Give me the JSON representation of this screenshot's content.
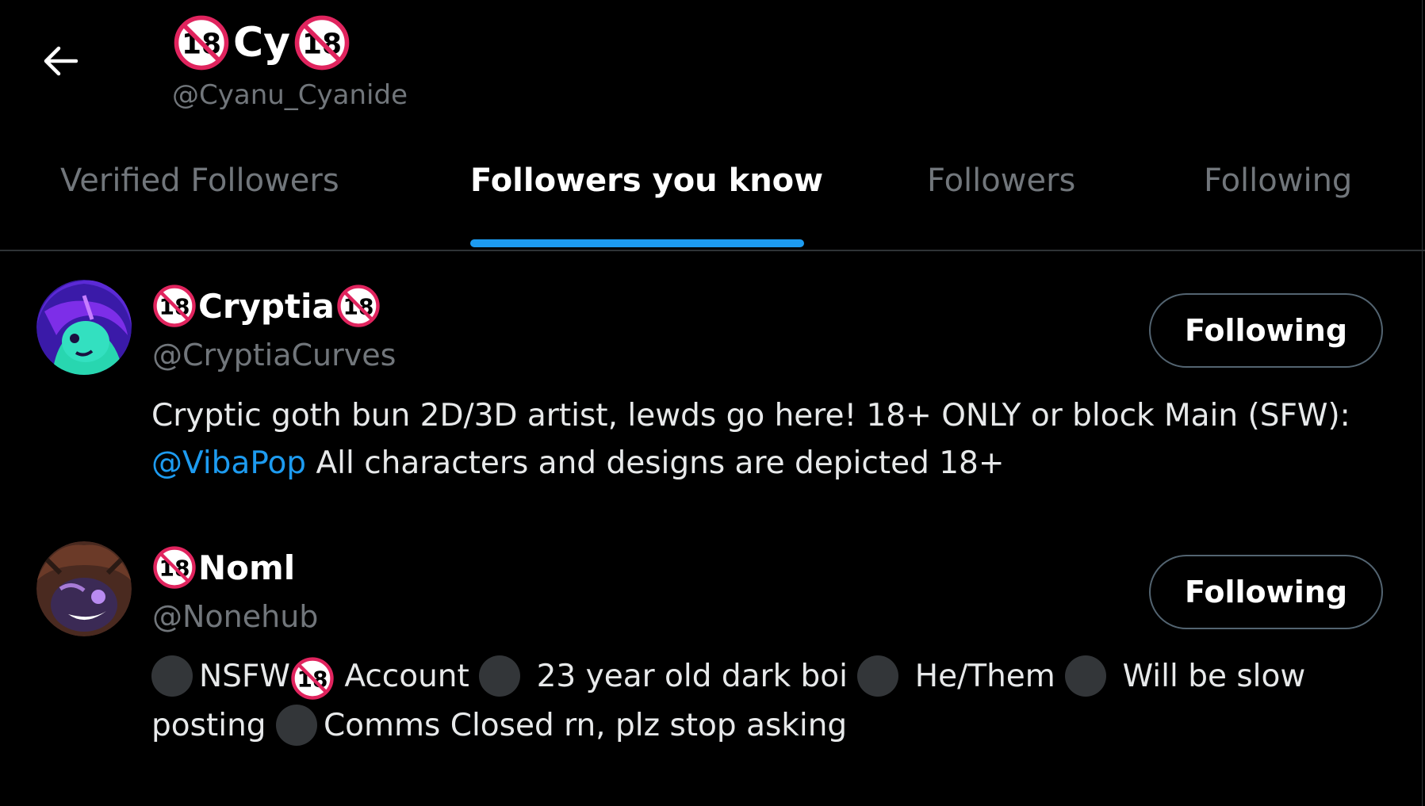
{
  "header": {
    "name": "Cy",
    "handle": "@Cyanu_Cyanide",
    "badge_label": "18"
  },
  "tabs": [
    {
      "label": "Verified Followers",
      "active": false
    },
    {
      "label": "Followers you know",
      "active": true
    },
    {
      "label": "Followers",
      "active": false
    },
    {
      "label": "Following",
      "active": false
    }
  ],
  "users": [
    {
      "name": "Cryptia",
      "handle": "@CryptiaCurves",
      "button_label": "Following",
      "bio_line1": "Cryptic goth bun 2D/3D artist, lewds go here! 18+ ONLY or block Main (SFW):",
      "bio_mention": "@VibaPop",
      "bio_line2": " All characters and designs are depicted 18+"
    },
    {
      "name": "Noml",
      "handle": "@Nonehub",
      "button_label": "Following",
      "bio_seg1": "NSFW",
      "bio_seg2": " Account ",
      "bio_seg3": " 23 year old dark boi ",
      "bio_seg4": " He/Them ",
      "bio_seg5": " Will be slow",
      "bio_seg6": "posting ",
      "bio_seg7": "Comms Closed rn, plz stop asking"
    }
  ],
  "colors": {
    "background": "#000000",
    "accent": "#1d9bf0",
    "muted_text": "#71767b",
    "badge_red": "#e0245e"
  }
}
